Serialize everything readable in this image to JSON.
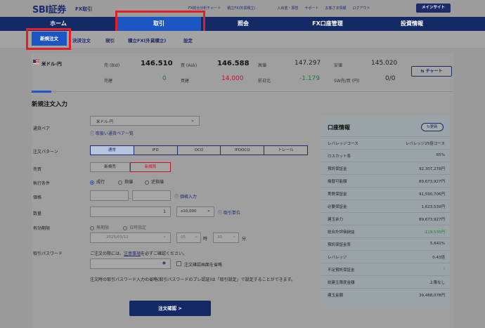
{
  "header": {
    "logo": "SBI証券",
    "logo_sub": "FX取引",
    "links": [
      "FX総合分析チャート",
      "積立FX(外貨積立)",
      "入出金・振替",
      "サポート",
      "お客さま情報",
      "ログアウト"
    ],
    "main_site": "メインサイト"
  },
  "nav": {
    "items": [
      "ホーム",
      "取引",
      "照会",
      "FX口座管理",
      "投資情報"
    ]
  },
  "subnav": {
    "items": [
      "新規注文",
      "決済注文",
      "現引",
      "積立FX(外貨積立)",
      "設定"
    ]
  },
  "quote": {
    "flag_icon": "us-flag-icon",
    "pair": "米ドル-円",
    "bid_label": "売 (Bid)",
    "bid": "146.510",
    "ask_label": "買 (Ask)",
    "ask": "146.588",
    "high_label": "高値",
    "high": "147.297",
    "low_label": "安値",
    "low": "145.020",
    "sell_pos_label": "売建",
    "sell_pos": "0",
    "buy_pos_label": "買建",
    "buy_pos": "14,000",
    "change_label": "前日比",
    "change": "-1.179",
    "sw_label": "SW売/買 (円)",
    "sw": "0/0",
    "chart_button": "チャート"
  },
  "form": {
    "title": "新規注文入力",
    "pair_label": "通貨ペア",
    "pair_value": "米ドル-円",
    "pair_help": "取扱い通貨ペア一覧",
    "pattern_label": "注文パターン",
    "patterns": [
      "通常",
      "IFD",
      "OCO",
      "IFDOCO",
      "トレール"
    ],
    "side_label": "売買",
    "sides": [
      "新規売",
      "新規買"
    ],
    "exec_label": "執行条件",
    "exec_options": [
      "成行",
      "指値",
      "逆指値"
    ],
    "price_label": "価格",
    "price_input": "",
    "price_decimal": "",
    "price_help": "価格入力",
    "qty_label": "数量",
    "qty_value": "1",
    "qty_unit": "x10,000",
    "qty_help": "取引単位",
    "expiry_label": "有効期限",
    "expiry_options": [
      "無期限",
      "日時指定"
    ],
    "expiry_date": "2025/03/12",
    "expiry_hour": "05",
    "hour_suffix": "時",
    "expiry_min": "30",
    "min_suffix": "分",
    "pw_label": "取引パスワード",
    "pw_note_prefix": "ご注文の際には、",
    "pw_note_link": "注意事項",
    "pw_note_suffix": "を必ずご確認ください。",
    "pw_value": "",
    "skip_confirm": "注文確認画面を省略",
    "skip_note": "注文時の取引パスワード入力の省略(取引パスワードのプレ認証)は「取引設定」で設定することができます。",
    "confirm_button": "注文確認 >"
  },
  "account": {
    "title": "口座情報",
    "refresh": "更新",
    "rows": [
      {
        "k": "レバレッジコース",
        "v": "レバレッジ25倍コース"
      },
      {
        "k": "ロスカット率",
        "v": "65%"
      },
      {
        "k": "預託保証金",
        "v": "92,307,278円"
      },
      {
        "k": "振替可能額",
        "v": "89,673,927円"
      },
      {
        "k": "実質保証金",
        "v": "91,590,706円"
      },
      {
        "k": "必要保証金",
        "v": "1,623,539円"
      },
      {
        "k": "建玉余力",
        "v": "89,673,927円"
      },
      {
        "k": "総合計評価損益",
        "v": "-119,535円"
      },
      {
        "k": "預託保証金率",
        "v": "5,641%"
      },
      {
        "k": "レバレッジ",
        "v": "0.43倍"
      },
      {
        "k": "不足預託保証金",
        "v": "-"
      },
      {
        "k": "総建玉限度金額",
        "v": "上限なし"
      },
      {
        "k": "建玉金額",
        "v": "39,468,078円"
      }
    ]
  },
  "colors": {
    "nav_bg": "#142a66",
    "active_blue": "#1c55c4",
    "highlight_red": "#e31e24",
    "buy_red": "#c4102a",
    "green": "#1e7a3a"
  }
}
